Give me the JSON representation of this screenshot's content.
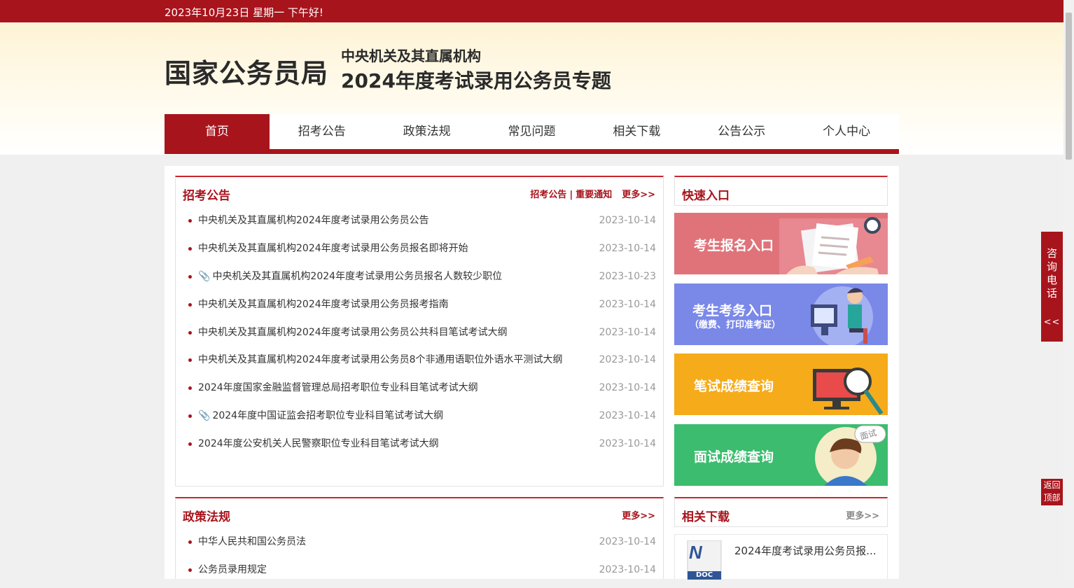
{
  "topbar": {
    "text": "2023年10月23日  星期一  下午好!"
  },
  "header": {
    "logo": "国家公务员局",
    "subtitle1": "中央机关及其直属机构",
    "subtitle2": "2024年度考试录用公务员专题"
  },
  "nav": [
    "首页",
    "招考公告",
    "政策法规",
    "常见问题",
    "相关下载",
    "公告公示",
    "个人中心"
  ],
  "announcements": {
    "title": "招考公告",
    "link1": "招考公告",
    "link2": "重要通知",
    "more": "更多>>",
    "items": [
      {
        "title": "中央机关及其直属机构2024年度考试录用公务员公告",
        "date": "2023-10-14",
        "clip": false
      },
      {
        "title": "中央机关及其直属机构2024年度考试录用公务员报名即将开始",
        "date": "2023-10-14",
        "clip": false
      },
      {
        "title": "中央机关及其直属机构2024年度考试录用公务员报名人数较少职位",
        "date": "2023-10-23",
        "clip": true
      },
      {
        "title": "中央机关及其直属机构2024年度考试录用公务员报考指南",
        "date": "2023-10-14",
        "clip": false
      },
      {
        "title": "中央机关及其直属机构2024年度考试录用公务员公共科目笔试考试大纲",
        "date": "2023-10-14",
        "clip": false
      },
      {
        "title": "中央机关及其直属机构2024年度考试录用公务员8个非通用语职位外语水平测试大纲",
        "date": "2023-10-14",
        "clip": false
      },
      {
        "title": "2024年度国家金融监督管理总局招考职位专业科目笔试考试大纲",
        "date": "2023-10-14",
        "clip": false
      },
      {
        "title": "2024年度中国证监会招考职位专业科目笔试考试大纲",
        "date": "2023-10-14",
        "clip": true
      },
      {
        "title": "2024年度公安机关人民警察职位专业科目笔试考试大纲",
        "date": "2023-10-14",
        "clip": false
      }
    ]
  },
  "quick": {
    "title": "快速入口",
    "entries": [
      {
        "label": "考生报名入口",
        "sub": "",
        "color": "#e0737a"
      },
      {
        "label": "考生考务入口",
        "sub": "（缴费、打印准考证）",
        "color": "#7a88e8"
      },
      {
        "label": "笔试成绩查询",
        "sub": "",
        "color": "#f6ab1a"
      },
      {
        "label": "面试成绩查询",
        "sub": "",
        "color": "#3cbc6e"
      }
    ],
    "bubble": "面试"
  },
  "policy": {
    "title": "政策法规",
    "more": "更多>>",
    "items": [
      {
        "title": "中华人民共和国公务员法",
        "date": "2023-10-14"
      },
      {
        "title": "公务员录用规定",
        "date": "2023-10-14"
      }
    ]
  },
  "downloads": {
    "title": "相关下载",
    "more": "更多>>",
    "item": "2024年度考试录用公务员报...",
    "doc_label": "DOC"
  },
  "float": {
    "text": "咨询电话",
    "arrow": "<<",
    "top": "返回顶部"
  }
}
